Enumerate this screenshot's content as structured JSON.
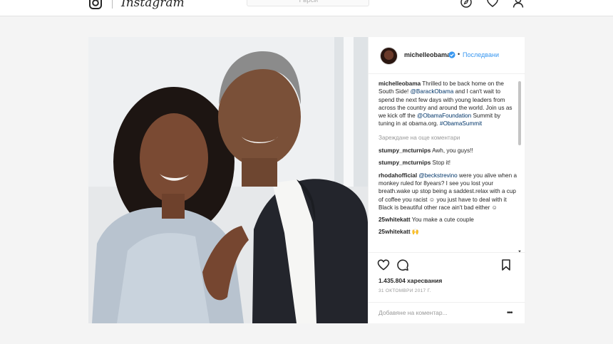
{
  "topbar": {
    "brand": "Instagram",
    "search_placeholder": "Търси"
  },
  "post": {
    "username": "michelleobama",
    "separator": "•",
    "follow_label": "Последвани",
    "caption": {
      "username": "michelleobama",
      "text_1": "Thrilled to be back home on the South Side!",
      "mention_1": "@BarackObama",
      "text_2": "and I can't wait to spend the next few days with young leaders from across the country and around the world. Join us as we kick off the",
      "mention_2": "@ObamaFoundation",
      "text_3": "Summit by tuning in at obama.org.",
      "hashtag": "#ObamaSummit"
    },
    "load_more": "Зареждане на още коментари",
    "comments": [
      {
        "username": "stumpy_mcturnips",
        "text": "Awh, you guys!!"
      },
      {
        "username": "stumpy_mcturnips",
        "text": "Stop it!"
      },
      {
        "username": "rhodahofficial",
        "mention": "@beckstrevino",
        "text": "were you alive when a monkey ruled for 8years? I see you lost your breath.wake up stop being a saddest.relax with a cup of coffee you racist ☺ you just have to deal with it Black is beautiful other race ain't bad either ☺"
      },
      {
        "username": "25whitekatt",
        "text": "You make a cute couple"
      },
      {
        "username": "25whitekatt",
        "text": "🙌"
      }
    ],
    "likes": "1.435.804 харесвания",
    "timestamp": "31 ОКТОМВРИ 2017 Г.",
    "add_comment_placeholder": "Добавяне на коментар...",
    "more_label": "•••"
  },
  "colors": {
    "accent": "#3897f0",
    "mention": "#003569",
    "muted": "#999999",
    "background": "#f4f4f4"
  },
  "icons": [
    "instagram-logo-icon",
    "compass-icon",
    "heart-icon",
    "user-icon",
    "verified-badge-icon",
    "comment-icon",
    "bookmark-icon",
    "more-options-icon"
  ]
}
